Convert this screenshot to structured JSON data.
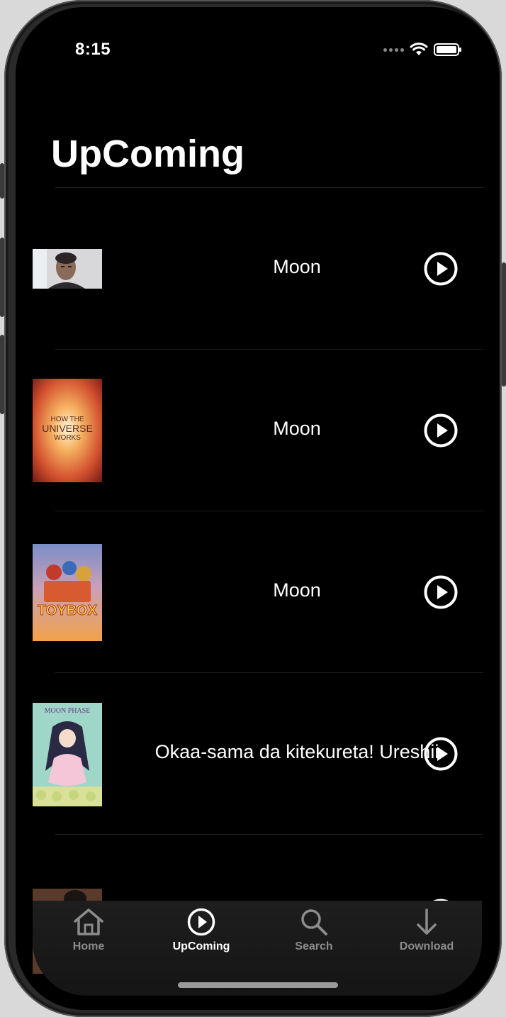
{
  "status_bar": {
    "time": "8:15"
  },
  "page": {
    "title": "UpComing"
  },
  "items": [
    {
      "title": "Moon",
      "poster": "man-face-poster"
    },
    {
      "title": "Moon",
      "poster": "how-the-universe-works-poster",
      "poster_text": "HOW THE UNIVERSE WORKS"
    },
    {
      "title": "Moon",
      "poster": "toybox-poster",
      "poster_text": "TOYBOX"
    },
    {
      "title": "Okaa-sama da kitekureta! Ureshii",
      "poster": "moon-phase-anime-poster",
      "poster_text": "MOON PHASE"
    },
    {
      "title": "",
      "poster": "partial-poster"
    }
  ],
  "tab_bar": {
    "tabs": [
      {
        "label": "Home",
        "icon": "house-icon",
        "active": false
      },
      {
        "label": "UpComing",
        "icon": "play-circle-icon",
        "active": true
      },
      {
        "label": "Search",
        "icon": "magnifier-icon",
        "active": false
      },
      {
        "label": "Download",
        "icon": "arrow-down-icon",
        "active": false
      }
    ]
  },
  "colors": {
    "background": "#000000",
    "text": "#ffffff",
    "tab_inactive": "#8c8c8c",
    "tab_bar": "#1e1e1e"
  }
}
